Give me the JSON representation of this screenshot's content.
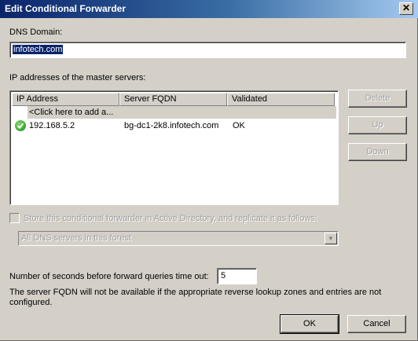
{
  "window": {
    "title": "Edit Conditional Forwarder",
    "close_glyph": "✕"
  },
  "dns_domain": {
    "label": "DNS Domain:",
    "value": "infotech.com"
  },
  "master_servers": {
    "label": "IP addresses of the master servers:",
    "columns": [
      "IP Address",
      "Server FQDN",
      "Validated"
    ],
    "add_row_text": "<Click here to add a...",
    "rows": [
      {
        "ip": "192.168.5.2",
        "fqdn": "bg-dc1-2k8.infotech.com",
        "validated": "OK",
        "status_icon": "check-circle-icon"
      }
    ]
  },
  "buttons": {
    "delete": "Delete",
    "up": "Up",
    "down": "Down",
    "ok": "OK",
    "cancel": "Cancel"
  },
  "store_ad": {
    "label": "Store this conditional forwarder in Active Directory, and replicate it as follows:",
    "checked": false,
    "replication_selected": "All DNS servers in this forest"
  },
  "timeout": {
    "label": "Number of seconds before forward queries time out:",
    "value": "5"
  },
  "note": {
    "line1": "The server FQDN will not be available if the appropriate reverse lookup zones and entries are not",
    "line2": "configured."
  },
  "colors": {
    "dialog_bg": "#d4d0c8",
    "titlebar_start": "#0a246a",
    "titlebar_end": "#a6caf0",
    "selection": "#0a246a",
    "ok_green": "#1c8a1c"
  }
}
